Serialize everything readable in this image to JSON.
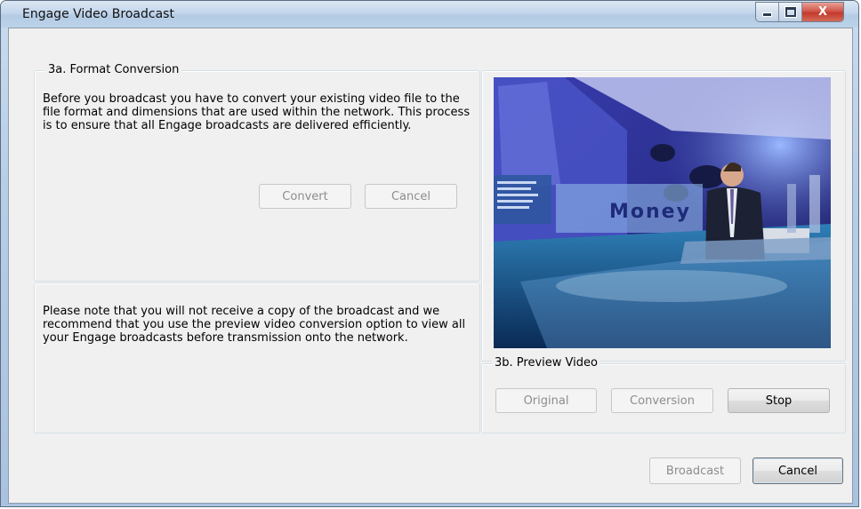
{
  "window": {
    "title": "Engage Video Broadcast",
    "controls": {
      "minimize": "minimize",
      "maximize": "maximize",
      "close": "X"
    }
  },
  "format_conversion": {
    "group_title": "3a. Format Conversion",
    "description": "Before you broadcast you have to convert your existing video file to the file format and dimensions that are used within the network. This process is to ensure that all Engage broadcasts are delivered efficiently.",
    "convert_label": "Convert",
    "cancel_label": "Cancel"
  },
  "note": {
    "text": "Please note that you will not receive a copy of the broadcast and we recommend that you use the preview video conversion option to view all your Engage broadcasts before transmission onto the network."
  },
  "preview": {
    "video_overlay_text": "Money",
    "group_title": "3b. Preview Video",
    "original_label": "Original",
    "conversion_label": "Conversion",
    "stop_label": "Stop"
  },
  "footer": {
    "broadcast_label": "Broadcast",
    "cancel_label": "Cancel"
  },
  "colors": {
    "titlebar": "#c3d6ec",
    "client_bg": "#f0f0f0",
    "close_button": "#c33a2c",
    "disabled_text": "#8d8d8d"
  }
}
